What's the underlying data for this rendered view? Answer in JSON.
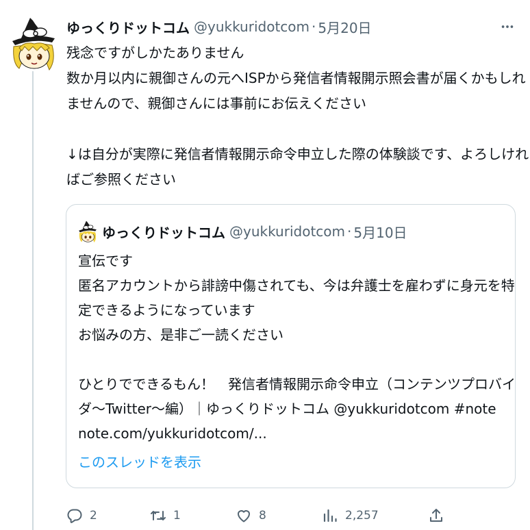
{
  "tweet": {
    "author_name": "ゆっくりドットコム",
    "author_handle": "@yukkuridotcom",
    "separator": "·",
    "date": "5月20日",
    "text_lines": [
      "残念ですがしかたありません",
      "数か月以内に親御さんの元へISPから発信者情報開示照会書が届くかもしれ",
      "ませんので、親御さんには事前にお伝えください",
      "",
      "↓は自分が実際に発信者情報開示命令申立した際の体験談です、よろしけれ",
      "ばご参照ください"
    ]
  },
  "quoted_tweet": {
    "author_name": "ゆっくりドットコム",
    "author_handle": "@yukkuridotcom",
    "separator": "·",
    "date": "5月10日",
    "text_lines": [
      "宣伝です",
      "匿名アカウントから誹謗中傷されても、今は弁護士を雇わずに身元を特",
      "定できるようになっています",
      "お悩みの方、是非ご一読ください",
      "",
      "ひとりでできるもん！　発信者情報開示命令申立（コンテンツプロバイ",
      "ダ〜Twitter〜編）｜ゆっくりドットコム @yukkuridotcom #note",
      "note.com/yukkuridotcom/..."
    ],
    "show_thread_label": "このスレッドを表示"
  },
  "actions": {
    "reply_count": "2",
    "retweet_count": "1",
    "like_count": "8",
    "view_count": "2,257"
  },
  "icons": {
    "more": "more-dots-icon",
    "reply": "reply-icon",
    "retweet": "retweet-icon",
    "like": "heart-icon",
    "views": "analytics-icon",
    "share": "share-icon"
  },
  "colors": {
    "text": "#0f1419",
    "secondary": "#536471",
    "link": "#1d9bf0",
    "border": "#cfd9de"
  }
}
